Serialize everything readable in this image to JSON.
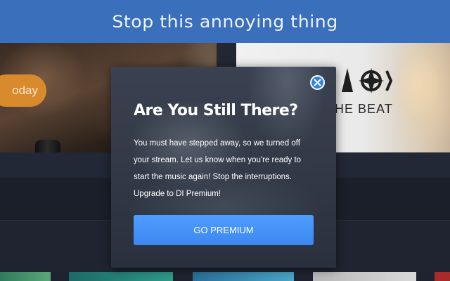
{
  "banner": {
    "title": "Stop this annoying thing"
  },
  "background": {
    "left_button_label": "oday",
    "right_card_text": "HE BEAT"
  },
  "modal": {
    "title": "Are You Still There?",
    "body": "You must have stepped away, so we turned off your stream. Let us know when you're ready to start the music again! Stop the interruptions. Upgrade to DI Premium!",
    "cta_label": "GO PREMIUM",
    "close_icon": "close-icon"
  },
  "colors": {
    "banner": "#3a6fbb",
    "accent": "#3c88f0",
    "page_background": "#1f2330",
    "orange_button": "#d98a2c"
  }
}
